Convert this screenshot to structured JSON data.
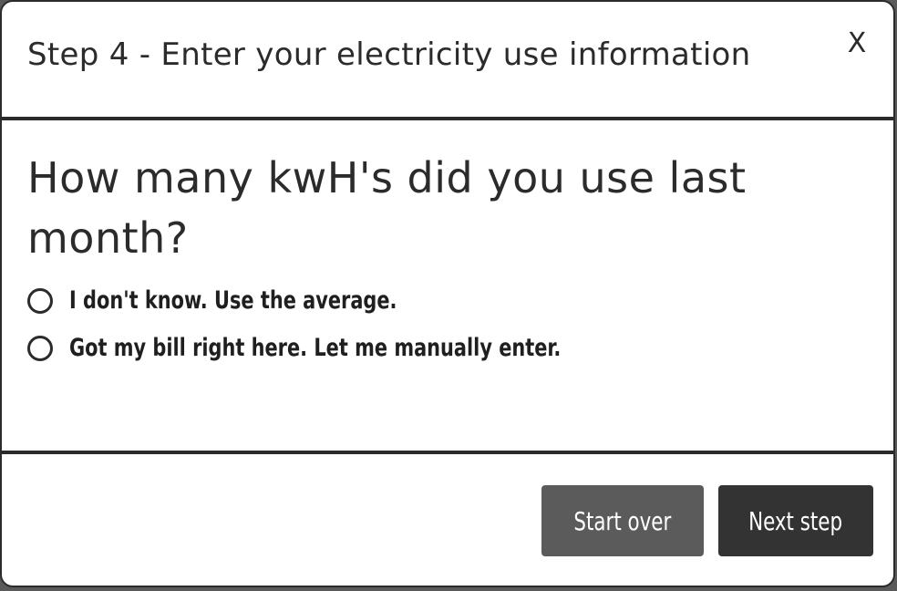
{
  "header": {
    "title": "Step 4 - Enter your electricity use information",
    "close_label": "X"
  },
  "body": {
    "question": "How many kwH's did you use last month?",
    "options": [
      {
        "label": "I don't know. Use the average.",
        "selected": false
      },
      {
        "label": "Got my bill right here. Let me manually enter.",
        "selected": false
      }
    ]
  },
  "footer": {
    "start_over_label": "Start over",
    "next_step_label": "Next step"
  },
  "colors": {
    "text": "#2b2b2b",
    "start_over_bg": "#5b5b5b",
    "next_step_bg": "#333333",
    "backdrop": "#5a5a5a"
  }
}
